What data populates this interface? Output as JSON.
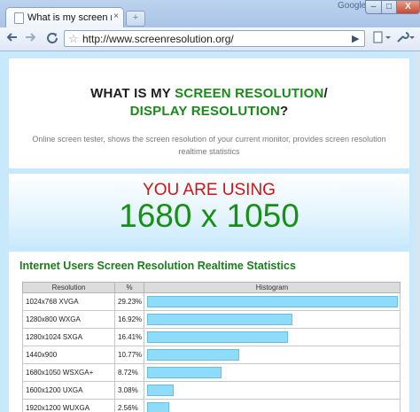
{
  "browser": {
    "tab_title": "What is my screen resolu...",
    "tab_close": "×",
    "new_tab": "+",
    "google_label": "Google",
    "window_buttons": {
      "minimize": "–",
      "maximize": "□",
      "close": "X"
    },
    "url": "http://www.screenresolution.org/"
  },
  "page": {
    "heading_part1": "WHAT IS MY ",
    "heading_part2": "SCREEN RESOLUTION",
    "heading_part3": "/",
    "heading_line2": "DISPLAY RESOLUTION",
    "heading_line2_end": "?",
    "description": "Online screen tester, shows the screen resolution of your current monitor, provides screen resolution realtime statistics",
    "using_label": "YOU ARE USING",
    "resolution": "1680 x 1050"
  },
  "stats": {
    "title": "Internet Users Screen Resolution Realtime Statistics",
    "headers": [
      "Resolution",
      "%",
      "Histogram"
    ],
    "rows": [
      {
        "resolution": "1024x768 XVGA",
        "percent": "29.23%",
        "value": 29.23
      },
      {
        "resolution": "1280x800 WXGA",
        "percent": "16.92%",
        "value": 16.92
      },
      {
        "resolution": "1280x1024 SXGA",
        "percent": "16.41%",
        "value": 16.41
      },
      {
        "resolution": "1440x900",
        "percent": "10.77%",
        "value": 10.77
      },
      {
        "resolution": "1680x1050 WSXGA+",
        "percent": "8.72%",
        "value": 8.72
      },
      {
        "resolution": "1600x1200 UXGA",
        "percent": "3.08%",
        "value": 3.08
      },
      {
        "resolution": "1920x1200 WUXGA",
        "percent": "2.56%",
        "value": 2.56
      }
    ]
  },
  "colors": {
    "page_bg": "#c7e9fb",
    "heading_green": "#1a8a1a",
    "using_red": "#d01414",
    "bar_fill": "#8fdcfa"
  },
  "icons": {
    "back": "back-arrow-icon",
    "forward": "forward-arrow-icon",
    "reload": "reload-icon",
    "home": "home-icon",
    "bookmark": "star-icon",
    "go": "play-icon",
    "page_menu": "page-menu-icon",
    "tools_menu": "wrench-icon"
  }
}
